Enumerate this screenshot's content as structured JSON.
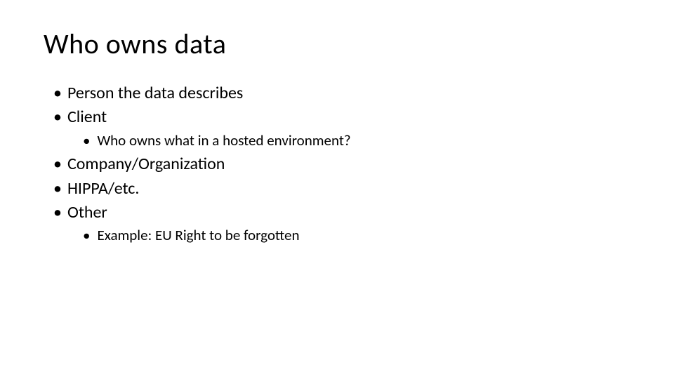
{
  "slide": {
    "title": "Who owns data",
    "bullets": [
      {
        "level": 1,
        "text": "Person the data describes"
      },
      {
        "level": 1,
        "text": "Client"
      },
      {
        "level": 2,
        "text": "Who owns what in a hosted environment?"
      },
      {
        "level": 1,
        "text": "Company/Organization"
      },
      {
        "level": 1,
        "text": "HIPPA/etc."
      },
      {
        "level": 1,
        "text": "Other"
      },
      {
        "level": 2,
        "text": "Example: EU Right to be forgotten"
      }
    ]
  }
}
